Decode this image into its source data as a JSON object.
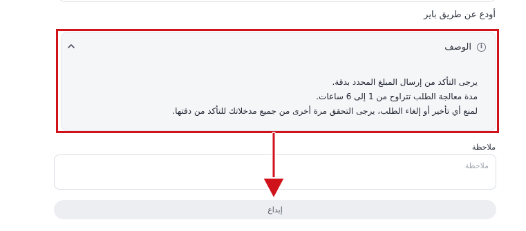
{
  "form": {
    "section_label": "أودع عن طريق باير"
  },
  "description": {
    "title": "الوصف",
    "info_icon": "info-icon",
    "collapse_icon": "chevron-up-icon",
    "lines": [
      "يرجى التأكد من إرسال المبلغ المحدد بدقة.",
      "مدة معالجة الطلب تتراوح من 1 إلى 6 ساعات.",
      "لمنع أي تأخير أو إلغاء الطلب، يرجى التحقق مرة أخرى من جميع مدخلاتك للتأكد من دقتها."
    ]
  },
  "note": {
    "label": "ملاحظة",
    "placeholder": "ملاحظة",
    "value": ""
  },
  "submit": {
    "label": "إيداع"
  },
  "annotation": {
    "highlight_color": "#d0121b",
    "arrow_color": "#d0121b"
  }
}
